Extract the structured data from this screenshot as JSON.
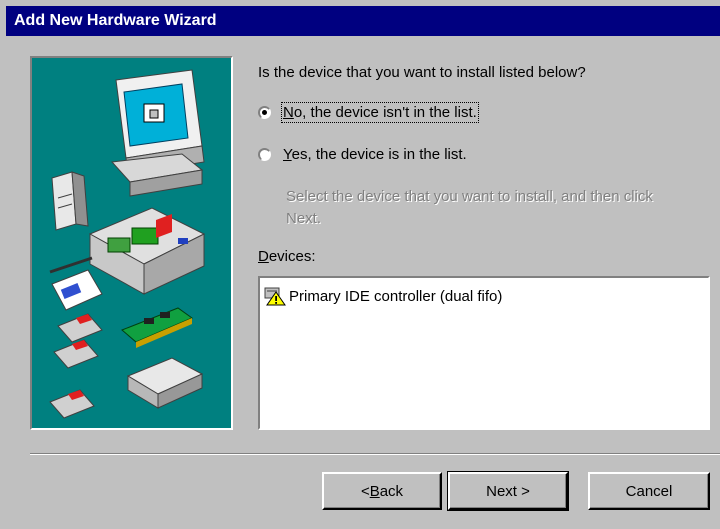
{
  "window": {
    "title": "Add New Hardware Wizard"
  },
  "illustration": {
    "name": "hardware-illustration"
  },
  "prompt": {
    "question": "Is the device that you want to install listed below?"
  },
  "options": [
    {
      "pre": "",
      "accel": "N",
      "post": "o, the device isn't in the list.",
      "checked": true
    },
    {
      "pre": "",
      "accel": "Y",
      "post": "es, the device is in the list.",
      "checked": false
    }
  ],
  "hint": "Select the device that you want to install, and then click Next.",
  "devices": {
    "label_accel": "D",
    "label_rest": "evices:",
    "items": [
      {
        "label": "Primary IDE controller (dual fifo)",
        "icon": "warning-device-icon"
      }
    ]
  },
  "buttons": {
    "back": {
      "pre": "< ",
      "accel": "B",
      "post": "ack"
    },
    "next": {
      "label": "Next >"
    },
    "cancel": {
      "label": "Cancel"
    }
  },
  "colors": {
    "title_bar": "#000080",
    "illustration_bg": "#008080",
    "face": "#c0c0c0"
  }
}
